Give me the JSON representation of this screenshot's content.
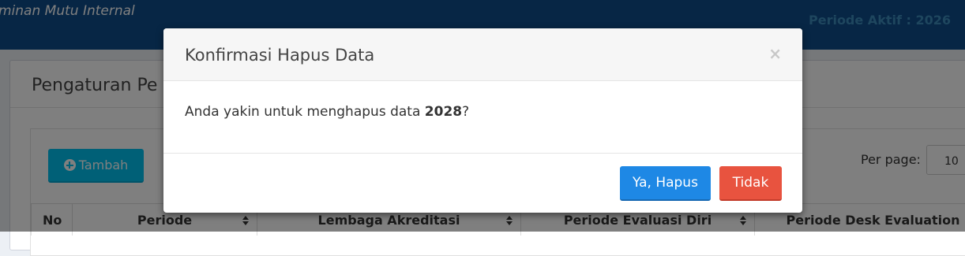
{
  "app": {
    "title": "minan Mutu Internal",
    "periode_aktif": "Periode Aktif : 2026"
  },
  "page": {
    "box_title": "Pengaturan Pe",
    "tambah_label": "Tambah",
    "per_page_label": "Per page:",
    "per_page_value": "10"
  },
  "table": {
    "headers": [
      "No",
      "Periode",
      "Lembaga Akreditasi",
      "Periode Evaluasi Diri",
      "Periode Desk Evaluation"
    ]
  },
  "modal": {
    "title": "Konfirmasi Hapus Data",
    "close_symbol": "×",
    "message_prefix": "Anda yakin untuk menghapus data ",
    "message_item": "2028",
    "message_suffix": "?",
    "confirm_label": "Ya, Hapus",
    "cancel_label": "Tidak"
  },
  "colors": {
    "topbar": "#0e4d8b",
    "accent_info": "#00c0ef",
    "primary": "#1e88e5",
    "danger": "#e8533f"
  }
}
